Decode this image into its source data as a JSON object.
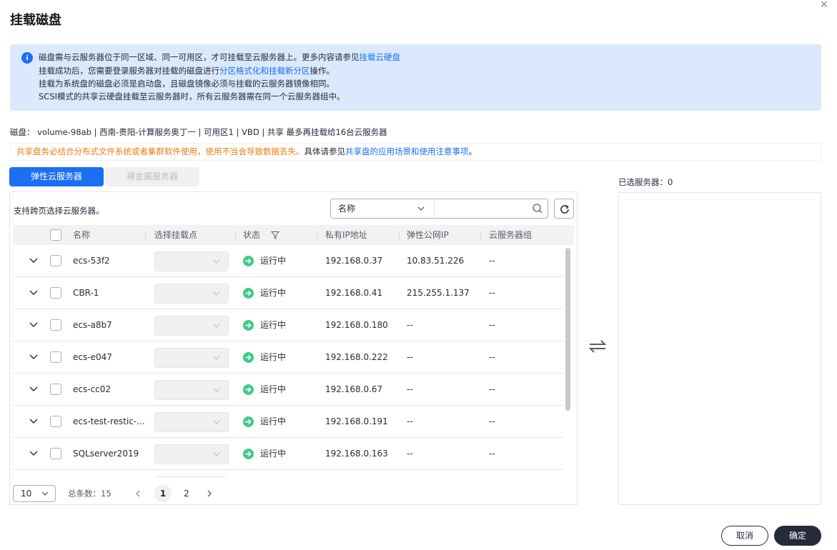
{
  "dialog": {
    "title": "挂载磁盘",
    "close_glyph": "✕"
  },
  "info": {
    "line1_pre": "磁盘需与云服务器位于同一区域、同一可用区，才可挂载至云服务器上。更多内容请参见",
    "line1_link": "挂载云硬盘",
    "line2_pre": "挂载成功后，您需要登录服务器对挂载的磁盘进行",
    "line2_link": "分区格式化和挂载新分区",
    "line2_post": "操作。",
    "line3": "挂载为系统盘的磁盘必须是启动盘，且磁盘镜像必须与挂载的云服务器镜像相同。",
    "line4": "SCSI模式的共享云硬盘挂载至云服务器时，所有云服务器需在同一个云服务器组中。"
  },
  "disk_info": "磁盘： volume-98ab  | 西南-贵阳-计算服务奥丁一 | 可用区1 | VBD | 共享  最多再挂载给16台云服务器",
  "warning": {
    "orange": "共享盘务必结合分布式文件系统或者集群软件使用，使用不当会导致数据丢失。",
    "mid": "具体请参见",
    "link": "共享盘的应用场景和使用注意事项",
    "end": "。"
  },
  "tabs": {
    "ecs": "弹性云服务器",
    "bms": "裸金属服务器"
  },
  "toolbar": {
    "cross_page": "支持跨页选择云服务器。",
    "search_field": "名称",
    "search_placeholder": ""
  },
  "table": {
    "headers": {
      "name": "名称",
      "mount": "选择挂载点",
      "status": "状态",
      "private_ip": "私有IP地址",
      "eip": "弹性公网IP",
      "group": "云服务器组"
    },
    "rows": [
      {
        "name": "ecs-53f2",
        "status": "运行中",
        "private_ip": "192.168.0.37",
        "eip": "10.83.51.226",
        "group": "--"
      },
      {
        "name": "CBR-1",
        "status": "运行中",
        "private_ip": "192.168.0.41",
        "eip": "215.255.1.137",
        "group": "--"
      },
      {
        "name": "ecs-a8b7",
        "status": "运行中",
        "private_ip": "192.168.0.180",
        "eip": "--",
        "group": "--"
      },
      {
        "name": "ecs-e047",
        "status": "运行中",
        "private_ip": "192.168.0.222",
        "eip": "--",
        "group": "--"
      },
      {
        "name": "ecs-cc02",
        "status": "运行中",
        "private_ip": "192.168.0.67",
        "eip": "--",
        "group": "--"
      },
      {
        "name": "ecs-test-restic-...",
        "status": "运行中",
        "private_ip": "192.168.0.191",
        "eip": "--",
        "group": "--"
      },
      {
        "name": "SQLserver2019",
        "status": "运行中",
        "private_ip": "192.168.0.163",
        "eip": "--",
        "group": "--"
      }
    ]
  },
  "pagination": {
    "page_size": "10",
    "total": "总条数：15",
    "pages": [
      "1",
      "2"
    ],
    "current": "1"
  },
  "selected": {
    "label": "已选服务器：0"
  },
  "buttons": {
    "cancel": "取消",
    "ok": "确定"
  },
  "colors": {
    "primary": "#1a6ff2",
    "running": "#3fcb8d",
    "warning": "#e97e0f",
    "dark": "#252b3a"
  }
}
